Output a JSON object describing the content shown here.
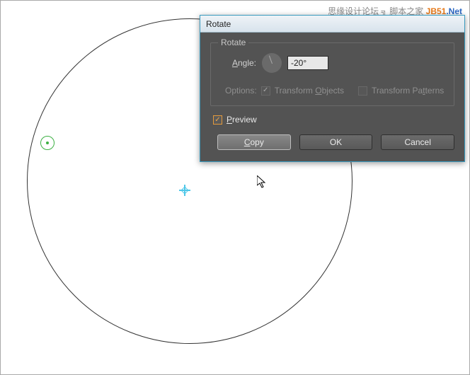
{
  "watermark": {
    "left": "思缘设计论坛 ╗ 脚本之家",
    "brand1": "JB51",
    "brand2": ".Net"
  },
  "canvas": {
    "big_circle": "selected-path-circle",
    "small_circle": "anchor-handle",
    "rotation_center": "rotation-center-marker"
  },
  "dialog": {
    "title": "Rotate",
    "group_label": "Rotate",
    "angle_label": "Angle:",
    "angle_value": "-20°",
    "options_label": "Options:",
    "transform_objects": "Transform Objects",
    "transform_patterns": "Transform Patterns",
    "preview_label": "Preview",
    "buttons": {
      "copy": "Copy",
      "ok": "OK",
      "cancel": "Cancel"
    }
  }
}
